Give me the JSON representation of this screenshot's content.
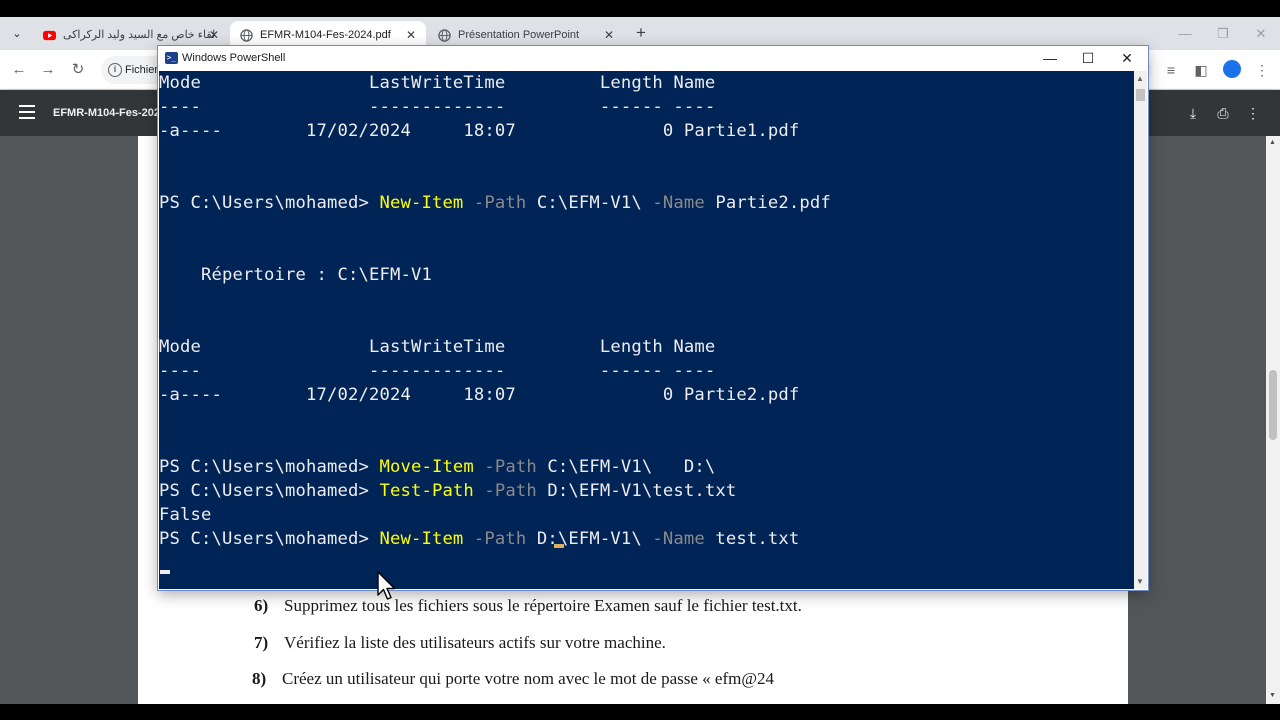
{
  "browser": {
    "tabs": [
      {
        "title": "لقاء خاص مع السيد وليد الركراكى",
        "icon": "youtube-icon",
        "active": false
      },
      {
        "title": "EFMR-M104-Fes-2024.pdf",
        "icon": "globe-icon",
        "active": true
      },
      {
        "title": "Présentation PowerPoint",
        "icon": "globe-icon",
        "active": false
      }
    ],
    "close_glyph": "✕",
    "new_tab_glyph": "+",
    "address_chip": "Fichier",
    "brand_blue": "#1a73e8"
  },
  "pdf": {
    "title": "EFMR-M104-Fes-202",
    "toolbar_color": "#323639",
    "lines": [
      {
        "num": "6)",
        "text": "Supprimez tous les fichiers sous le répertoire Examen sauf le fichier test.txt."
      },
      {
        "num": "7)",
        "text": "Vérifiez la liste des utilisateurs actifs sur votre machine."
      },
      {
        "num": "8)",
        "text": "Créez un utilisateur qui porte votre nom avec le mot de passe « efm@24"
      }
    ]
  },
  "powershell": {
    "window_title": "Windows PowerShell",
    "background": "#012456",
    "command_color": "#ffff00",
    "parameter_color": "#8a8a8a",
    "lines": [
      {
        "text": "Mode                LastWriteTime         Length Name"
      },
      {
        "text": "----                -------------         ------ ----"
      },
      {
        "text": "-a----        17/02/2024     18:07              0 Partie1.pdf"
      },
      {
        "text": ""
      },
      {
        "text": ""
      },
      {
        "prompt": "PS C:\\Users\\mohamed> ",
        "cmd": "New-Item",
        "p1": " -Path",
        "a1": " C:\\EFM-V1\\",
        "p2": " -Name",
        "a2": " Partie2.pdf"
      },
      {
        "text": ""
      },
      {
        "text": ""
      },
      {
        "text": "    Répertoire : C:\\EFM-V1"
      },
      {
        "text": ""
      },
      {
        "text": ""
      },
      {
        "text": "Mode                LastWriteTime         Length Name"
      },
      {
        "text": "----                -------------         ------ ----"
      },
      {
        "text": "-a----        17/02/2024     18:07              0 Partie2.pdf"
      },
      {
        "text": ""
      },
      {
        "text": ""
      },
      {
        "prompt": "PS C:\\Users\\mohamed> ",
        "cmd": "Move-Item",
        "p1": " -Path",
        "a1": " C:\\EFM-V1\\   D:\\"
      },
      {
        "prompt": "PS C:\\Users\\mohamed> ",
        "cmd": "Test-Path",
        "p1": " -Path",
        "a1": " D:\\EFM-V1\\test.txt"
      },
      {
        "text": "False"
      },
      {
        "prompt": "PS C:\\Users\\mohamed> ",
        "cmd": "New-Item",
        "p1": " -Path",
        "a1": " D:\\EFM-V1\\",
        "p2": " -Name",
        "a2": " test.txt"
      }
    ]
  }
}
